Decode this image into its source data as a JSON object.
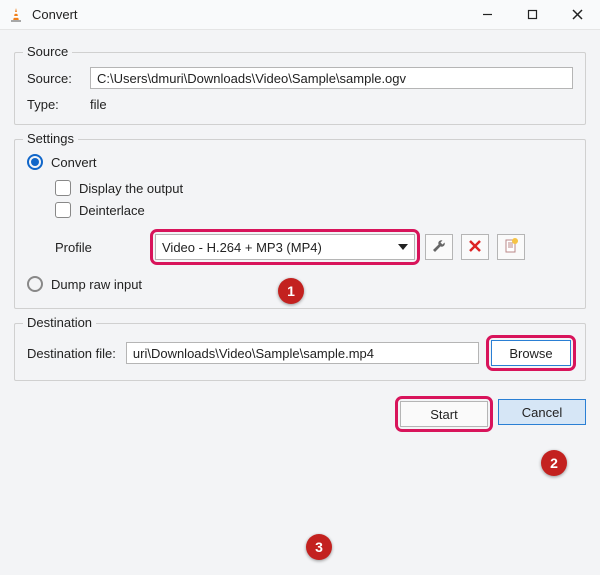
{
  "window": {
    "title": "Convert"
  },
  "source": {
    "legend": "Source",
    "source_label": "Source:",
    "source_value": "C:\\Users\\dmuri\\Downloads\\Video\\Sample\\sample.ogv",
    "type_label": "Type:",
    "type_value": "file"
  },
  "settings": {
    "legend": "Settings",
    "convert_label": "Convert",
    "display_output_label": "Display the output",
    "deinterlace_label": "Deinterlace",
    "profile_label": "Profile",
    "profile_selected": "Video - H.264 + MP3 (MP4)",
    "dump_raw_label": "Dump raw input"
  },
  "destination": {
    "legend": "Destination",
    "file_label": "Destination file:",
    "file_value": "uri\\Downloads\\Video\\Sample\\sample.mp4",
    "browse_label": "Browse"
  },
  "footer": {
    "start_label": "Start",
    "cancel_label": "Cancel"
  },
  "badges": {
    "b1": "1",
    "b2": "2",
    "b3": "3"
  }
}
